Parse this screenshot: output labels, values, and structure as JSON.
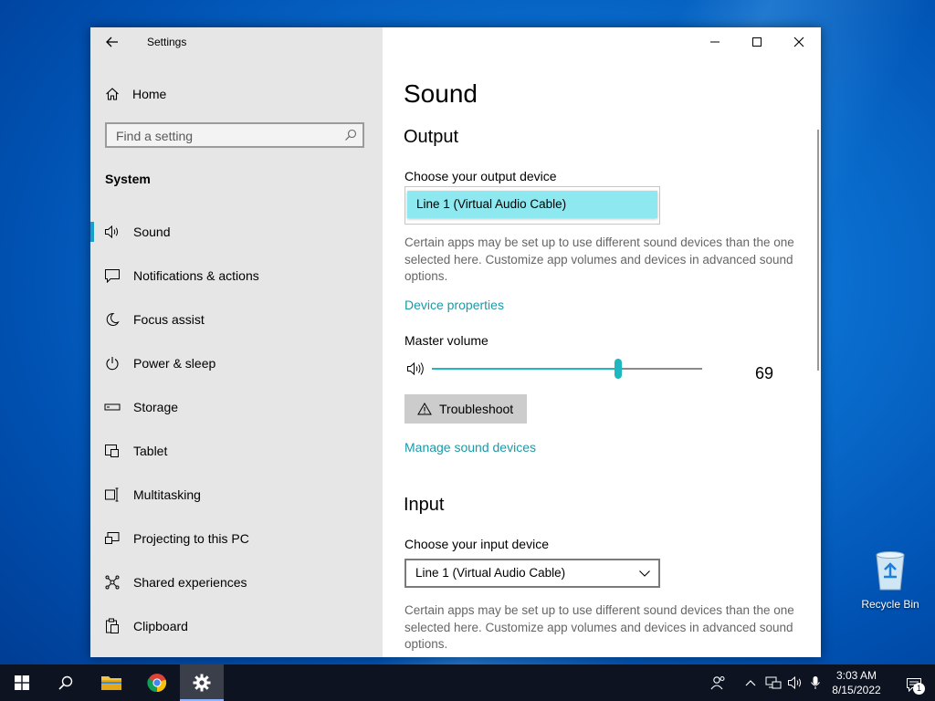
{
  "window": {
    "app_title": "Settings"
  },
  "sidebar": {
    "home_label": "Home",
    "search_placeholder": "Find a setting",
    "section_label": "System",
    "items": [
      {
        "label": "Sound",
        "icon": "speaker-icon",
        "active": true
      },
      {
        "label": "Notifications & actions",
        "icon": "notification-icon"
      },
      {
        "label": "Focus assist",
        "icon": "moon-icon"
      },
      {
        "label": "Power & sleep",
        "icon": "power-icon"
      },
      {
        "label": "Storage",
        "icon": "storage-icon"
      },
      {
        "label": "Tablet",
        "icon": "tablet-icon"
      },
      {
        "label": "Multitasking",
        "icon": "multitasking-icon"
      },
      {
        "label": "Projecting to this PC",
        "icon": "projecting-icon"
      },
      {
        "label": "Shared experiences",
        "icon": "shared-experiences-icon"
      },
      {
        "label": "Clipboard",
        "icon": "clipboard-icon"
      }
    ]
  },
  "content": {
    "page_title": "Sound",
    "output": {
      "heading": "Output",
      "device_label": "Choose your output device",
      "device_value": "Line 1 (Virtual Audio Cable)",
      "description": "Certain apps may be set up to use different sound devices than the one selected here. Customize app volumes and devices in advanced sound options.",
      "device_properties_link": "Device properties",
      "master_volume_label": "Master volume",
      "volume": 69,
      "volume_display": "69",
      "troubleshoot_label": "Troubleshoot",
      "manage_link": "Manage sound devices"
    },
    "input": {
      "heading": "Input",
      "device_label": "Choose your input device",
      "device_value": "Line 1 (Virtual Audio Cable)",
      "description": "Certain apps may be set up to use different sound devices than the one selected here. Customize app volumes and devices in advanced sound options."
    }
  },
  "desktop": {
    "recycle_bin_label": "Recycle Bin"
  },
  "taskbar": {
    "time": "3:03 AM",
    "date": "8/15/2022",
    "notification_count": "1"
  },
  "colors": {
    "accent": "#1aa0c8",
    "link": "#1a9aa8",
    "slider": "#1fb7c0",
    "dropdown_highlight": "#8de8f0",
    "taskbar": "#0d1321"
  }
}
